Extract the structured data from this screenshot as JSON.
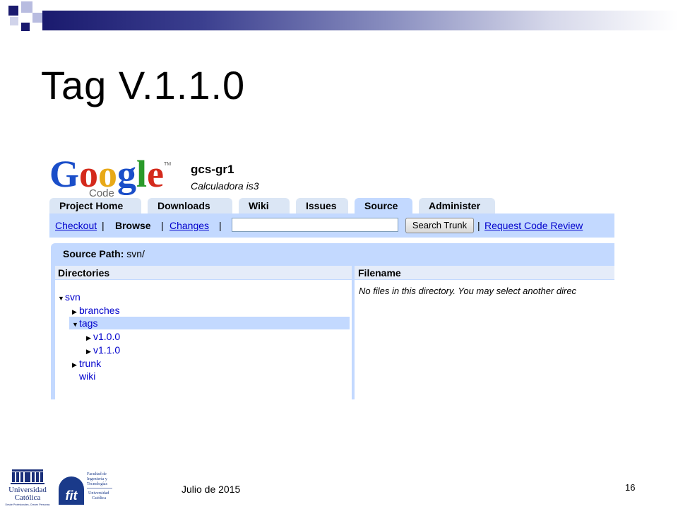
{
  "slide": {
    "title": "Tag V.1.1.0",
    "footer_date": "Julio de 2015",
    "page_number": "16"
  },
  "logos": {
    "google_code": {
      "word": "Google",
      "tm": "TM",
      "sub": "Code"
    },
    "universidad": {
      "line1": "Universidad",
      "line2": "Católica",
      "line3": "Desde Profesionales, Crecen Personas"
    },
    "facultad": {
      "lines": [
        "Facultad de",
        "Ingeniería y",
        "Tecnologías",
        "Universidad",
        "Católica"
      ],
      "mark": "fit"
    }
  },
  "project": {
    "name": "gcs-gr1",
    "description": "Calculadora is3"
  },
  "tabs": [
    {
      "label": "Project Home",
      "active": false
    },
    {
      "label": "Downloads",
      "active": false
    },
    {
      "label": "Wiki",
      "active": false
    },
    {
      "label": "Issues",
      "active": false
    },
    {
      "label": "Source",
      "active": true
    },
    {
      "label": "Administer",
      "active": false
    }
  ],
  "subnav": {
    "checkout": "Checkout",
    "sep": "|",
    "browse": "Browse",
    "changes": "Changes",
    "search_value": "",
    "search_button": "Search Trunk",
    "request_review": "Request Code Review"
  },
  "source_path": {
    "label": "Source Path:",
    "value": "svn/"
  },
  "directories": {
    "header": "Directories",
    "items": [
      {
        "label": "svn",
        "expanded": true,
        "selected": false
      },
      {
        "label": "branches",
        "expanded": false,
        "selected": false
      },
      {
        "label": "tags",
        "expanded": true,
        "selected": true
      },
      {
        "label": "v1.0.0",
        "expanded": false,
        "selected": false
      },
      {
        "label": "v1.1.0",
        "expanded": false,
        "selected": false
      },
      {
        "label": "trunk",
        "expanded": false,
        "selected": false
      },
      {
        "label": "wiki",
        "expanded": false,
        "selected": false
      }
    ]
  },
  "files": {
    "header": "Filename",
    "empty_message": "No files in this directory. You may select another direc"
  },
  "colors": {
    "accent": "#c3d9ff",
    "tab": "#dbe6f5",
    "link": "#0000cc",
    "slide_bar": "#1a1a6e"
  }
}
